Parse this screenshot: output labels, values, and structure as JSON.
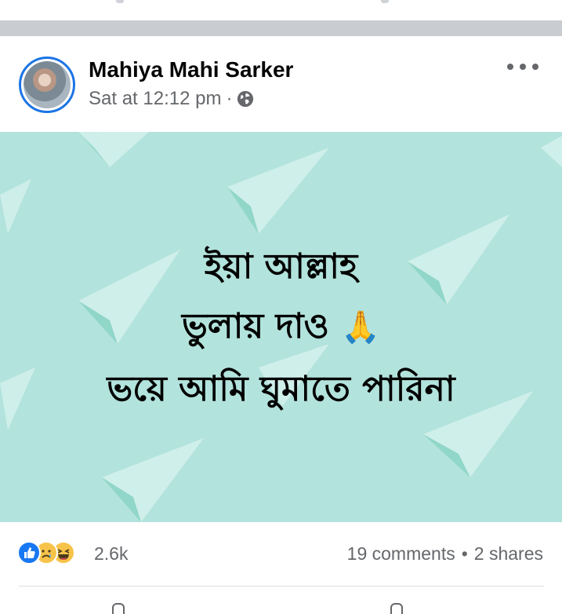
{
  "post": {
    "author": "Mahiya Mahi Sarker",
    "timestamp": "Sat at 12:12 pm",
    "separator": "·",
    "privacy_icon": "globe-icon",
    "more_icon": "more-horizontal-icon",
    "image": {
      "line1": "ইয়া আল্লাহ",
      "line2": "ভুলায় দাও",
      "line2_emoji": "🙏",
      "line3": "ভয়ে আমি ঘুমাতে পারিনা",
      "background_color": "#b2e3dc"
    }
  },
  "reactions": {
    "icons": [
      "like-icon",
      "sad-icon",
      "haha-icon"
    ],
    "count": "2.6k",
    "comments": "19 comments",
    "bullet": "•",
    "shares": "2 shares"
  },
  "colors": {
    "accent": "#1877f2",
    "secondary_text": "#65676b",
    "separator": "#c9ccd1"
  }
}
